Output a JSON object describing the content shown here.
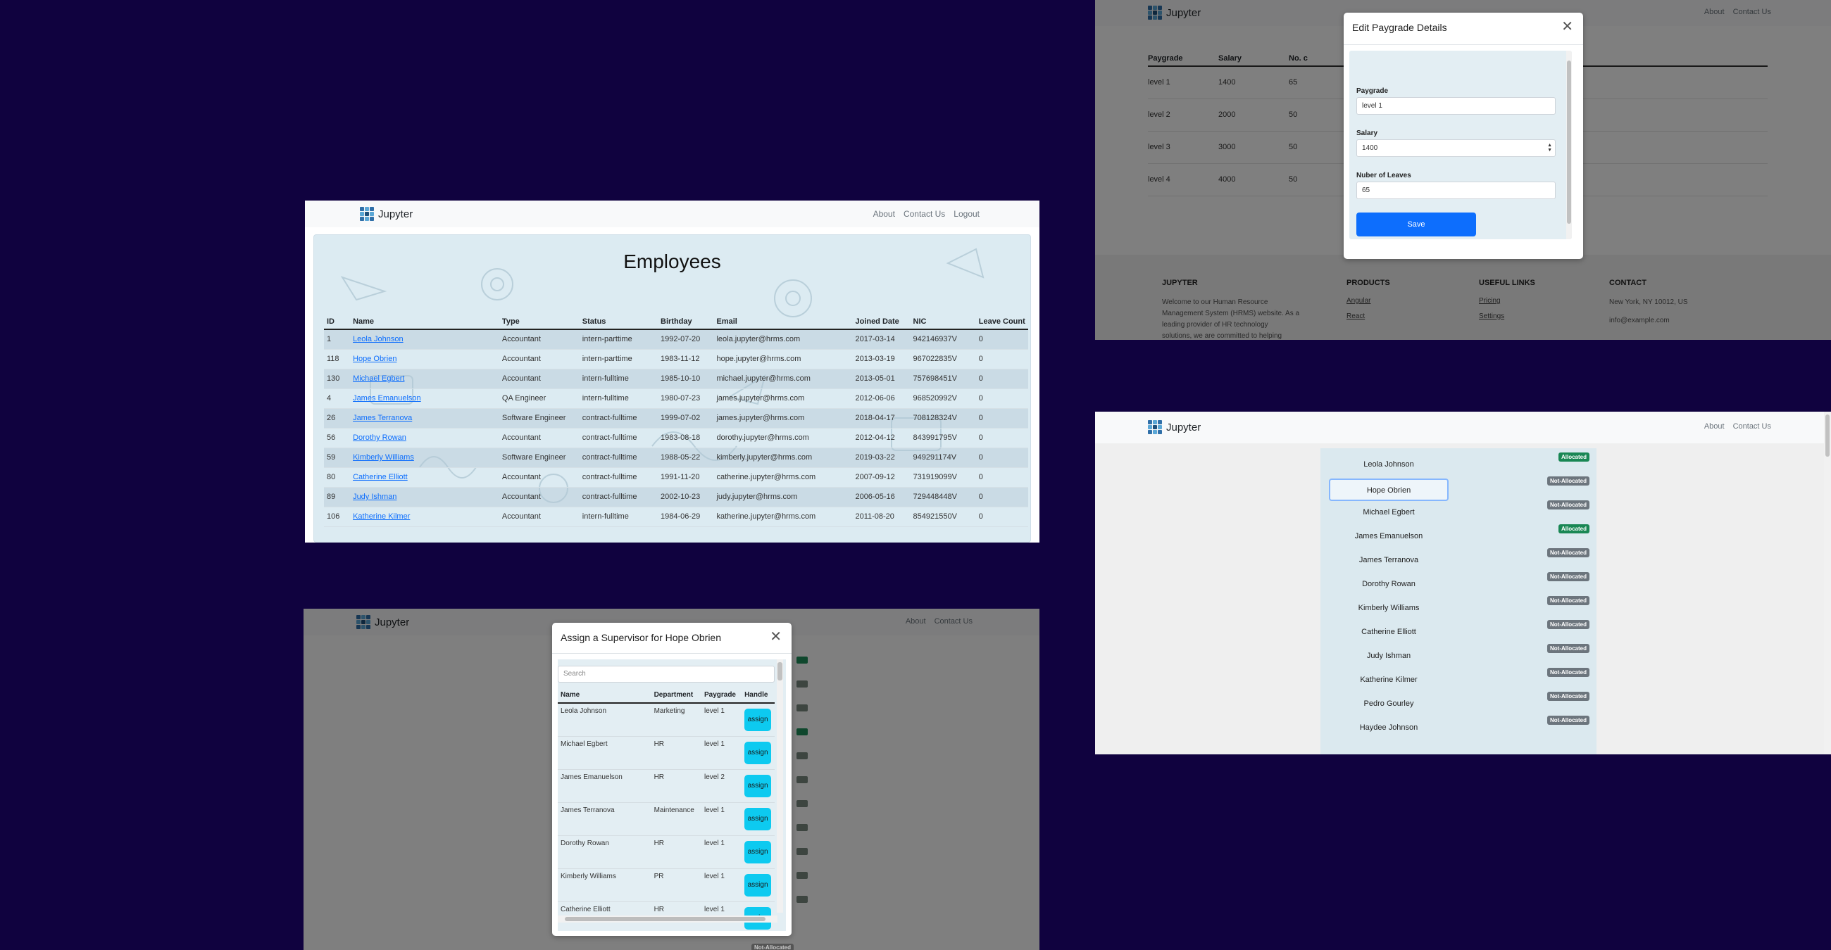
{
  "brand": "Jupyter",
  "employees_window": {
    "nav_links": [
      "About",
      "Contact Us",
      "Logout"
    ],
    "title": "Employees",
    "columns": [
      "ID",
      "Name",
      "Type",
      "Status",
      "Birthday",
      "Email",
      "Joined Date",
      "NIC",
      "Leave Count"
    ],
    "rows": [
      [
        "1",
        "Leola Johnson",
        "Accountant",
        "intern-parttime",
        "1992-07-20",
        "leola.jupyter@hrms.com",
        "2017-03-14",
        "942146937V",
        "0"
      ],
      [
        "118",
        "Hope Obrien",
        "Accountant",
        "intern-parttime",
        "1983-11-12",
        "hope.jupyter@hrms.com",
        "2013-03-19",
        "967022835V",
        "0"
      ],
      [
        "130",
        "Michael Egbert",
        "Accountant",
        "intern-fulltime",
        "1985-10-10",
        "michael.jupyter@hrms.com",
        "2013-05-01",
        "757698451V",
        "0"
      ],
      [
        "4",
        "James Emanuelson",
        "QA Engineer",
        "intern-fulltime",
        "1980-07-23",
        "james.jupyter@hrms.com",
        "2012-06-06",
        "968520992V",
        "0"
      ],
      [
        "26",
        "James Terranova",
        "Software Engineer",
        "contract-fulltime",
        "1999-07-02",
        "james.jupyter@hrms.com",
        "2018-04-17",
        "708128324V",
        "0"
      ],
      [
        "56",
        "Dorothy Rowan",
        "Accountant",
        "contract-fulltime",
        "1983-08-18",
        "dorothy.jupyter@hrms.com",
        "2012-04-12",
        "843991795V",
        "0"
      ],
      [
        "59",
        "Kimberly Williams",
        "Software Engineer",
        "contract-fulltime",
        "1988-05-22",
        "kimberly.jupyter@hrms.com",
        "2019-03-22",
        "949291174V",
        "0"
      ],
      [
        "80",
        "Catherine Elliott",
        "Accountant",
        "contract-fulltime",
        "1991-11-20",
        "catherine.jupyter@hrms.com",
        "2007-09-12",
        "731919099V",
        "0"
      ],
      [
        "89",
        "Judy Ishman",
        "Accountant",
        "contract-fulltime",
        "2002-10-23",
        "judy.jupyter@hrms.com",
        "2006-05-16",
        "729448448V",
        "0"
      ],
      [
        "106",
        "Katherine Kilmer",
        "Accountant",
        "intern-fulltime",
        "1984-06-29",
        "katherine.jupyter@hrms.com",
        "2011-08-20",
        "854921550V",
        "0"
      ]
    ]
  },
  "paygrade_window": {
    "nav_links": [
      "About",
      "Contact Us"
    ],
    "columns": [
      "Paygrade",
      "Salary",
      "No. c"
    ],
    "rows": [
      [
        "level 1",
        "1400",
        "65"
      ],
      [
        "level 2",
        "2000",
        "50"
      ],
      [
        "level 3",
        "3000",
        "50"
      ],
      [
        "level 4",
        "4000",
        "50"
      ]
    ],
    "footer": {
      "brand_heading": "JUPYTER",
      "brand_text": [
        "Welcome to our Human Resource",
        "Management System (HRMS) website. As a",
        "leading provider of HR technology",
        "solutions, we are committed to helping"
      ],
      "products_heading": "PRODUCTS",
      "products": [
        "Angular",
        "React"
      ],
      "links_heading": "USEFUL LINKS",
      "links": [
        "Pricing",
        "Settings"
      ],
      "contact_heading": "CONTACT",
      "contact": [
        "New York, NY 10012, US",
        "info@example.com"
      ]
    },
    "modal": {
      "title": "Edit Paygrade Details",
      "paygrade_label": "Paygrade",
      "paygrade_value": "level 1",
      "salary_label": "Salary",
      "salary_value": "1400",
      "leaves_label": "Nuber of Leaves",
      "leaves_value": "65",
      "save_label": "Save"
    }
  },
  "allocation_window": {
    "nav_links": [
      "About",
      "Contact Us"
    ],
    "items": [
      {
        "name": "Leola Johnson",
        "status": "Allocated"
      },
      {
        "name": "Hope Obrien",
        "status": "Not-Allocated",
        "selected": true
      },
      {
        "name": "Michael Egbert",
        "status": "Not-Allocated"
      },
      {
        "name": "James Emanuelson",
        "status": "Allocated"
      },
      {
        "name": "James Terranova",
        "status": "Not-Allocated"
      },
      {
        "name": "Dorothy Rowan",
        "status": "Not-Allocated"
      },
      {
        "name": "Kimberly Williams",
        "status": "Not-Allocated"
      },
      {
        "name": "Catherine Elliott",
        "status": "Not-Allocated"
      },
      {
        "name": "Judy Ishman",
        "status": "Not-Allocated"
      },
      {
        "name": "Katherine Kilmer",
        "status": "Not-Allocated"
      },
      {
        "name": "Pedro Gourley",
        "status": "Not-Allocated"
      },
      {
        "name": "Haydee Johnson",
        "status": "Not-Allocated"
      }
    ]
  },
  "supervisor_window": {
    "nav_links": [
      "About",
      "Contact Us"
    ],
    "modal": {
      "title": "Assign a Supervisor for Hope Obrien",
      "search_placeholder": "Search",
      "columns": [
        "Name",
        "Department",
        "Paygrade",
        "Handle"
      ],
      "button_label": "assign",
      "rows": [
        [
          "Leola Johnson",
          "Marketing",
          "level 1"
        ],
        [
          "Michael Egbert",
          "HR",
          "level 1"
        ],
        [
          "James Emanuelson",
          "HR",
          "level 2"
        ],
        [
          "James Terranova",
          "Maintenance",
          "level 1"
        ],
        [
          "Dorothy Rowan",
          "HR",
          "level 1"
        ],
        [
          "Kimberly Williams",
          "PR",
          "level 1"
        ],
        [
          "Catherine Elliott",
          "HR",
          "level 1"
        ]
      ],
      "bottom_badge": "Not-Allocated"
    }
  },
  "colors": {
    "desktop": "#10023f",
    "primary": "#0d6efd",
    "info": "#0dcaf0",
    "success": "#198754",
    "secondary": "#6c757d"
  },
  "icons": [
    "jupyter-logo-icon",
    "close-icon",
    "spinner-icon"
  ]
}
